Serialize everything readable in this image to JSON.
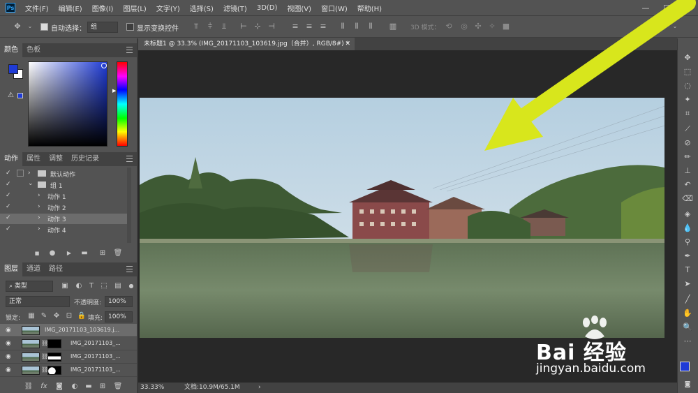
{
  "app": {
    "logo_text": "Ps"
  },
  "menubar": {
    "items": [
      "文件(F)",
      "编辑(E)",
      "图像(I)",
      "图层(L)",
      "文字(Y)",
      "选择(S)",
      "滤镜(T)",
      "3D(D)",
      "视图(V)",
      "窗口(W)",
      "帮助(H)"
    ],
    "window_controls": [
      "—",
      "☐",
      "✕"
    ]
  },
  "options": {
    "auto_select_label": "自动选择：",
    "auto_select_target": "组",
    "show_transform_label": "显示变换控件",
    "mode3d_label": "3D 模式："
  },
  "document": {
    "tab_title": "未标题1 @ 33.3% (IMG_20171103_103619.jpg（合并）, RGB/8#) *",
    "zoom": "33.33%",
    "doc_info": "文档:10.9M/65.1M"
  },
  "color_panel": {
    "tabs": [
      "颜色",
      "色板"
    ],
    "foreground": "#1f3bd6",
    "background": "#ffffff"
  },
  "actions_panel": {
    "tabs": [
      "动作",
      "属性",
      "调整",
      "历史记录"
    ],
    "rows": [
      {
        "name": "默认动作",
        "kind": "set",
        "indent": 0
      },
      {
        "name": "组 1",
        "kind": "set-open",
        "indent": 0
      },
      {
        "name": "动作 1",
        "kind": "action",
        "indent": 1
      },
      {
        "name": "动作 2",
        "kind": "action",
        "indent": 1
      },
      {
        "name": "动作 3",
        "kind": "action",
        "indent": 1,
        "selected": true
      },
      {
        "name": "动作 4",
        "kind": "action",
        "indent": 1
      }
    ]
  },
  "layers_panel": {
    "tabs": [
      "图层",
      "通道",
      "路径"
    ],
    "filter_label": "类型",
    "blend_mode": "正常",
    "opacity_label": "不透明度:",
    "opacity": "100%",
    "lock_label": "锁定:",
    "fill_label": "填充:",
    "fill": "100%",
    "layers": [
      {
        "name": "IMG_20171103_103619.j...",
        "has_mask": false,
        "selected": true
      },
      {
        "name": "IMG_20171103_...",
        "has_mask": true
      },
      {
        "name": "IMG_20171103_...",
        "has_mask": true
      },
      {
        "name": "IMG_20171103_...",
        "has_mask": true
      }
    ]
  },
  "watermark": {
    "brand": "Bai 经验",
    "url": "jingyan.baidu.com"
  },
  "colors": {
    "arrow": "#d8e61c",
    "ui_bg": "#535353",
    "canvas_bg": "#282828"
  }
}
